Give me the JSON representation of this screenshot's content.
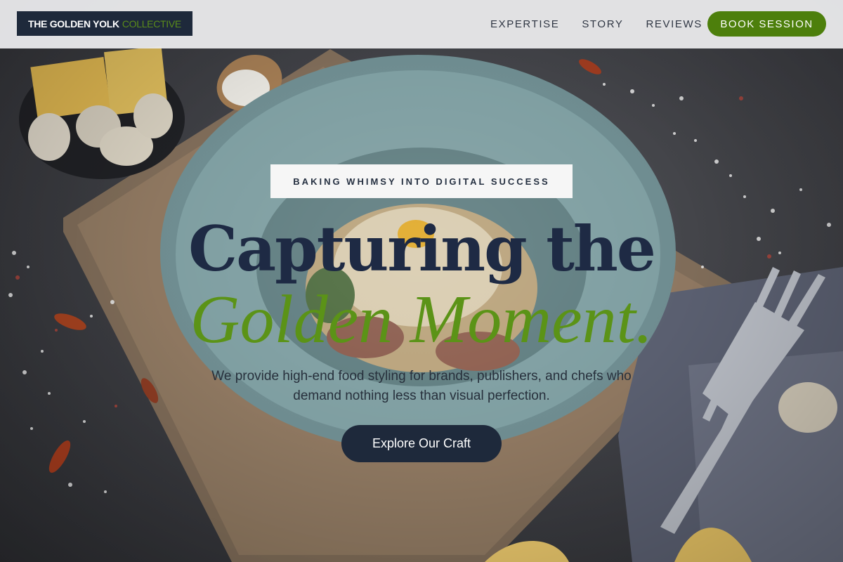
{
  "brand": {
    "name_main": "THE GOLDEN YOLK",
    "name_accent": "COLLECTIVE",
    "accent_color": "#5b8c1a"
  },
  "nav": {
    "items": [
      {
        "label": "EXPERTISE"
      },
      {
        "label": "STORY"
      },
      {
        "label": "REVIEWS"
      }
    ],
    "book_button": "BOOK SESSION",
    "book_button_color": "#4d7f0c"
  },
  "hero": {
    "tagline": "BAKING WHIMSY INTO DIGITAL SUCCESS",
    "headline_line1": "Capturing the",
    "headline_line2": "Golden Moment.",
    "headline_color": "#1e2a44",
    "headline_accent_color": "#5b9317",
    "subtext": "We provide high-end food styling for brands, publishers, and chefs who demand nothing less than visual perfection.",
    "cta": "Explore Our Craft"
  }
}
